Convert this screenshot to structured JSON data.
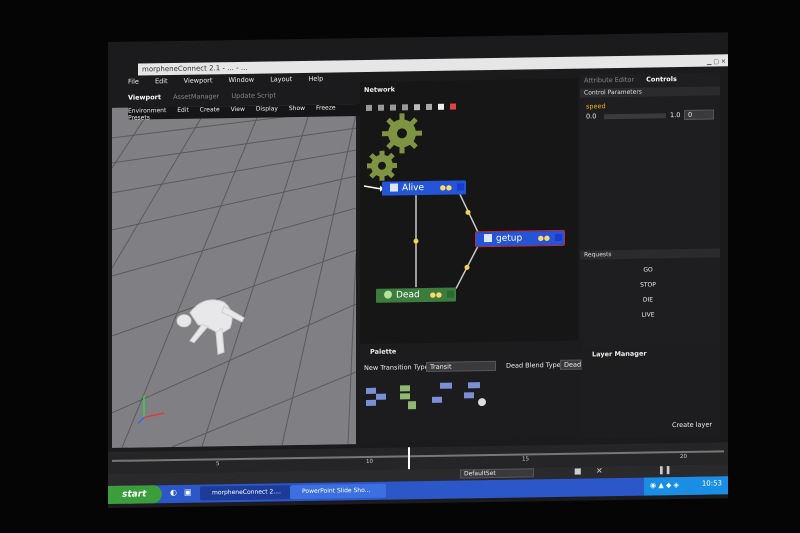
{
  "window": {
    "title": "morpheneConnect 2.1 - ... - ..."
  },
  "menu": [
    "File",
    "Edit",
    "Viewport",
    "Window",
    "Layout",
    "Help"
  ],
  "viewport": {
    "tabs": [
      "Viewport",
      "AssetManager",
      "Update Script"
    ],
    "menu": [
      "Environment",
      "Edit",
      "Create",
      "View",
      "Display",
      "Show",
      "Freeze",
      "Presets"
    ]
  },
  "network": {
    "title": "Network",
    "nodes": {
      "alive": "Alive",
      "getup": "getup",
      "dead": "Dead"
    }
  },
  "attributes": {
    "tabs": [
      "Attribute Editor",
      "Controls"
    ],
    "control_parameters": "Control Parameters",
    "param_name": "speed",
    "param_min": "0.0",
    "param_max": "1.0",
    "param_value": "0",
    "requests_header": "Requests",
    "requests": [
      "GO",
      "STOP",
      "DIE",
      "LIVE"
    ]
  },
  "palette": {
    "title": "Palette",
    "transition_label": "New Transition Type",
    "transition_value": "Transit",
    "blend_label": "Dead Blend Type",
    "blend_value": "Dead I"
  },
  "layers": {
    "title": "Layer Manager",
    "create": "Create layer"
  },
  "timeline": {
    "ticks": [
      "5",
      "10",
      "15",
      "20"
    ],
    "default_set": "DefaultSet"
  },
  "taskbar": {
    "start": "start",
    "tasks": [
      "morpheneConnect 2....",
      "PowerPoint Slide Sho..."
    ],
    "clock": "10:53"
  },
  "colors": {
    "node_blue": "#2455d6",
    "node_green": "#3c7d3e",
    "selected_outline": "#c5263b",
    "gear": "#7f9443"
  }
}
